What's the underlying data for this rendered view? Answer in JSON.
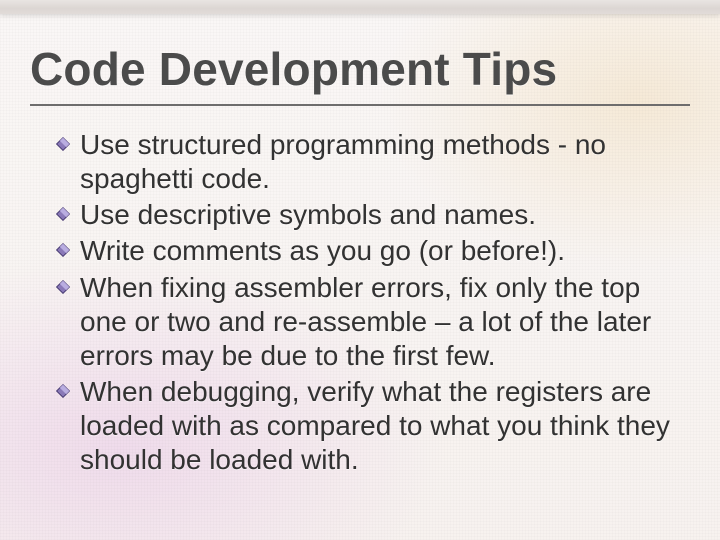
{
  "title": "Code Development Tips",
  "bullets": [
    "Use structured programming methods - no spaghetti code.",
    "Use descriptive symbols and names.",
    "Write comments as you go (or before!).",
    "When fixing assembler errors, fix only the top one or two and re-assemble – a lot of the later errors may be due to the first few.",
    "When debugging, verify what the registers are loaded with as compared to what you think they should be loaded with."
  ]
}
